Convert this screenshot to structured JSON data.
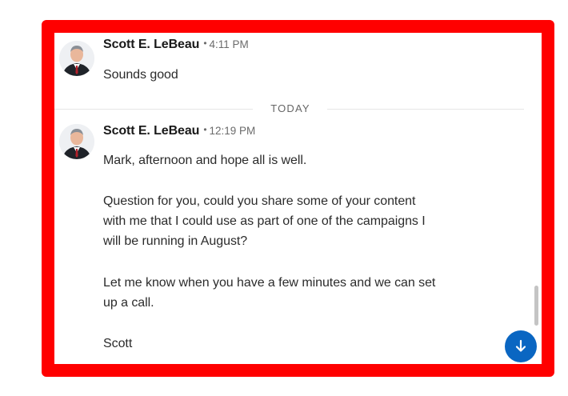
{
  "thread": {
    "divider_label": "TODAY",
    "messages": [
      {
        "sender": "Scott E. LeBeau",
        "separator": "•",
        "time": "4:11 PM",
        "avatar_icon": "person-avatar-icon",
        "lines": [
          "Sounds good"
        ]
      },
      {
        "sender": "Scott E. LeBeau",
        "separator": "•",
        "time": "12:19 PM",
        "avatar_icon": "person-avatar-icon",
        "lines": [
          "Mark, afternoon and hope all is well.",
          "Question for you, could you share some of your content",
          "with me that I could use as part of one of the campaigns I",
          "will be running in August?",
          "Let me know when you have a few minutes and we can set",
          "up a call.",
          "Scott"
        ]
      }
    ]
  },
  "controls": {
    "scroll_to_bottom_icon": "arrow-down-icon"
  },
  "colors": {
    "highlight_border": "#ff0000",
    "accent": "#0a66c2"
  }
}
